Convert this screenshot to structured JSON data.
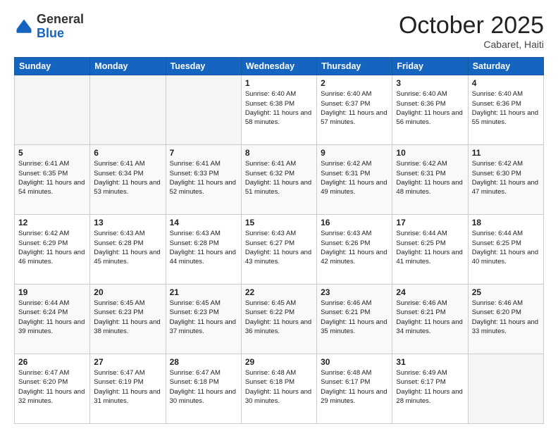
{
  "logo": {
    "line1": "General",
    "line2": "Blue"
  },
  "header": {
    "month": "October 2025",
    "location": "Cabaret, Haiti"
  },
  "weekdays": [
    "Sunday",
    "Monday",
    "Tuesday",
    "Wednesday",
    "Thursday",
    "Friday",
    "Saturday"
  ],
  "weeks": [
    [
      {
        "day": "",
        "sunrise": "",
        "sunset": "",
        "daylight": ""
      },
      {
        "day": "",
        "sunrise": "",
        "sunset": "",
        "daylight": ""
      },
      {
        "day": "",
        "sunrise": "",
        "sunset": "",
        "daylight": ""
      },
      {
        "day": "1",
        "sunrise": "Sunrise: 6:40 AM",
        "sunset": "Sunset: 6:38 PM",
        "daylight": "Daylight: 11 hours and 58 minutes."
      },
      {
        "day": "2",
        "sunrise": "Sunrise: 6:40 AM",
        "sunset": "Sunset: 6:37 PM",
        "daylight": "Daylight: 11 hours and 57 minutes."
      },
      {
        "day": "3",
        "sunrise": "Sunrise: 6:40 AM",
        "sunset": "Sunset: 6:36 PM",
        "daylight": "Daylight: 11 hours and 56 minutes."
      },
      {
        "day": "4",
        "sunrise": "Sunrise: 6:40 AM",
        "sunset": "Sunset: 6:36 PM",
        "daylight": "Daylight: 11 hours and 55 minutes."
      }
    ],
    [
      {
        "day": "5",
        "sunrise": "Sunrise: 6:41 AM",
        "sunset": "Sunset: 6:35 PM",
        "daylight": "Daylight: 11 hours and 54 minutes."
      },
      {
        "day": "6",
        "sunrise": "Sunrise: 6:41 AM",
        "sunset": "Sunset: 6:34 PM",
        "daylight": "Daylight: 11 hours and 53 minutes."
      },
      {
        "day": "7",
        "sunrise": "Sunrise: 6:41 AM",
        "sunset": "Sunset: 6:33 PM",
        "daylight": "Daylight: 11 hours and 52 minutes."
      },
      {
        "day": "8",
        "sunrise": "Sunrise: 6:41 AM",
        "sunset": "Sunset: 6:32 PM",
        "daylight": "Daylight: 11 hours and 51 minutes."
      },
      {
        "day": "9",
        "sunrise": "Sunrise: 6:42 AM",
        "sunset": "Sunset: 6:31 PM",
        "daylight": "Daylight: 11 hours and 49 minutes."
      },
      {
        "day": "10",
        "sunrise": "Sunrise: 6:42 AM",
        "sunset": "Sunset: 6:31 PM",
        "daylight": "Daylight: 11 hours and 48 minutes."
      },
      {
        "day": "11",
        "sunrise": "Sunrise: 6:42 AM",
        "sunset": "Sunset: 6:30 PM",
        "daylight": "Daylight: 11 hours and 47 minutes."
      }
    ],
    [
      {
        "day": "12",
        "sunrise": "Sunrise: 6:42 AM",
        "sunset": "Sunset: 6:29 PM",
        "daylight": "Daylight: 11 hours and 46 minutes."
      },
      {
        "day": "13",
        "sunrise": "Sunrise: 6:43 AM",
        "sunset": "Sunset: 6:28 PM",
        "daylight": "Daylight: 11 hours and 45 minutes."
      },
      {
        "day": "14",
        "sunrise": "Sunrise: 6:43 AM",
        "sunset": "Sunset: 6:28 PM",
        "daylight": "Daylight: 11 hours and 44 minutes."
      },
      {
        "day": "15",
        "sunrise": "Sunrise: 6:43 AM",
        "sunset": "Sunset: 6:27 PM",
        "daylight": "Daylight: 11 hours and 43 minutes."
      },
      {
        "day": "16",
        "sunrise": "Sunrise: 6:43 AM",
        "sunset": "Sunset: 6:26 PM",
        "daylight": "Daylight: 11 hours and 42 minutes."
      },
      {
        "day": "17",
        "sunrise": "Sunrise: 6:44 AM",
        "sunset": "Sunset: 6:25 PM",
        "daylight": "Daylight: 11 hours and 41 minutes."
      },
      {
        "day": "18",
        "sunrise": "Sunrise: 6:44 AM",
        "sunset": "Sunset: 6:25 PM",
        "daylight": "Daylight: 11 hours and 40 minutes."
      }
    ],
    [
      {
        "day": "19",
        "sunrise": "Sunrise: 6:44 AM",
        "sunset": "Sunset: 6:24 PM",
        "daylight": "Daylight: 11 hours and 39 minutes."
      },
      {
        "day": "20",
        "sunrise": "Sunrise: 6:45 AM",
        "sunset": "Sunset: 6:23 PM",
        "daylight": "Daylight: 11 hours and 38 minutes."
      },
      {
        "day": "21",
        "sunrise": "Sunrise: 6:45 AM",
        "sunset": "Sunset: 6:23 PM",
        "daylight": "Daylight: 11 hours and 37 minutes."
      },
      {
        "day": "22",
        "sunrise": "Sunrise: 6:45 AM",
        "sunset": "Sunset: 6:22 PM",
        "daylight": "Daylight: 11 hours and 36 minutes."
      },
      {
        "day": "23",
        "sunrise": "Sunrise: 6:46 AM",
        "sunset": "Sunset: 6:21 PM",
        "daylight": "Daylight: 11 hours and 35 minutes."
      },
      {
        "day": "24",
        "sunrise": "Sunrise: 6:46 AM",
        "sunset": "Sunset: 6:21 PM",
        "daylight": "Daylight: 11 hours and 34 minutes."
      },
      {
        "day": "25",
        "sunrise": "Sunrise: 6:46 AM",
        "sunset": "Sunset: 6:20 PM",
        "daylight": "Daylight: 11 hours and 33 minutes."
      }
    ],
    [
      {
        "day": "26",
        "sunrise": "Sunrise: 6:47 AM",
        "sunset": "Sunset: 6:20 PM",
        "daylight": "Daylight: 11 hours and 32 minutes."
      },
      {
        "day": "27",
        "sunrise": "Sunrise: 6:47 AM",
        "sunset": "Sunset: 6:19 PM",
        "daylight": "Daylight: 11 hours and 31 minutes."
      },
      {
        "day": "28",
        "sunrise": "Sunrise: 6:47 AM",
        "sunset": "Sunset: 6:18 PM",
        "daylight": "Daylight: 11 hours and 30 minutes."
      },
      {
        "day": "29",
        "sunrise": "Sunrise: 6:48 AM",
        "sunset": "Sunset: 6:18 PM",
        "daylight": "Daylight: 11 hours and 30 minutes."
      },
      {
        "day": "30",
        "sunrise": "Sunrise: 6:48 AM",
        "sunset": "Sunset: 6:17 PM",
        "daylight": "Daylight: 11 hours and 29 minutes."
      },
      {
        "day": "31",
        "sunrise": "Sunrise: 6:49 AM",
        "sunset": "Sunset: 6:17 PM",
        "daylight": "Daylight: 11 hours and 28 minutes."
      },
      {
        "day": "",
        "sunrise": "",
        "sunset": "",
        "daylight": ""
      }
    ]
  ]
}
